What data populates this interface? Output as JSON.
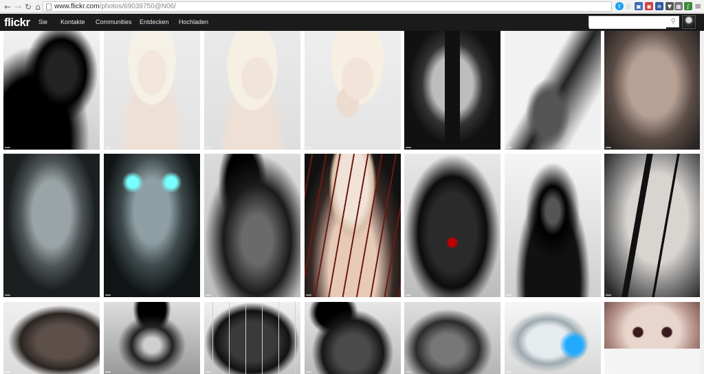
{
  "browser": {
    "url_host": "www.flickr.com",
    "url_path": "/photos/69039750@N06/"
  },
  "flickr": {
    "logo": "flickr",
    "nav": [
      "Sie",
      "Kontakte",
      "Communities",
      "Entdecken",
      "Hochladen"
    ],
    "search_placeholder": ""
  },
  "photos": [
    {
      "theme": "dark-figure"
    },
    {
      "theme": "blonde-closed-eyes"
    },
    {
      "theme": "blonde-portrait"
    },
    {
      "theme": "blonde-hand"
    },
    {
      "theme": "painted-face"
    },
    {
      "theme": "profile-neck"
    },
    {
      "theme": "male-closeup"
    },
    {
      "theme": "robot-helmet"
    },
    {
      "theme": "cyan-helmet"
    },
    {
      "theme": "torso-shadow"
    },
    {
      "theme": "blonde-neck-wounds"
    },
    {
      "theme": "back-red-mark"
    },
    {
      "theme": "dark-bob-cyber"
    },
    {
      "theme": "face-black-tears"
    },
    {
      "theme": "bald-profile"
    },
    {
      "theme": "shoulders-silver"
    },
    {
      "theme": "back-spine"
    },
    {
      "theme": "dark-torso"
    },
    {
      "theme": "crouching-figure"
    },
    {
      "theme": "android-cyan"
    },
    {
      "theme": "masked-face"
    }
  ]
}
